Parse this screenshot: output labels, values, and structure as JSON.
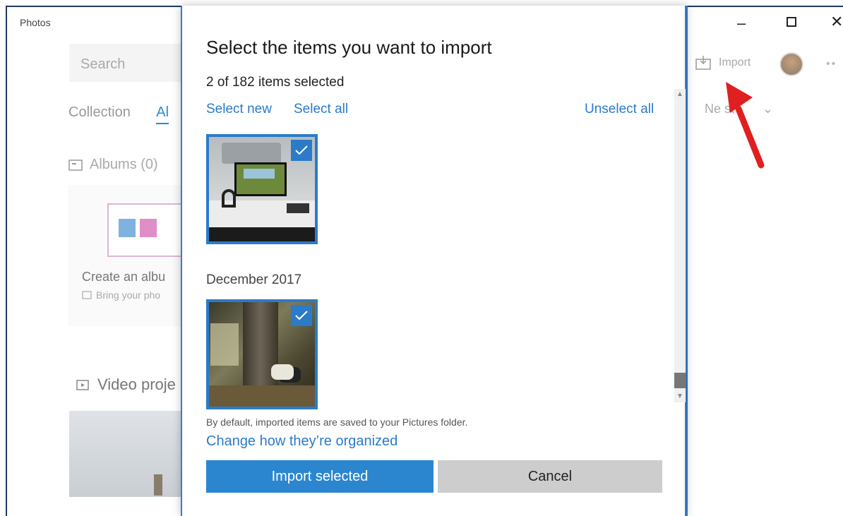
{
  "app": {
    "title": "Photos",
    "search_placeholder": "Search",
    "tabs": [
      "Collection",
      "Al"
    ],
    "albums_label": "Albums (0)",
    "album_create": "Create an albu",
    "album_bring": "Bring your pho",
    "video_label": "Video proje",
    "import_label": "Import",
    "sort_label": "Ne   st"
  },
  "dialog": {
    "title": "Select the items you want to import",
    "count": "2 of 182 items selected",
    "select_new": "Select new",
    "select_all": "Select all",
    "unselect_all": "Unselect all",
    "month_group": "December 2017",
    "note": "By default, imported items are saved to your Pictures folder.",
    "organize_link": "Change how they’re organized",
    "import_button": "Import selected",
    "cancel_button": "Cancel"
  },
  "colors": {
    "accent": "#2b86cf",
    "annotation_arrow": "#e02020"
  }
}
